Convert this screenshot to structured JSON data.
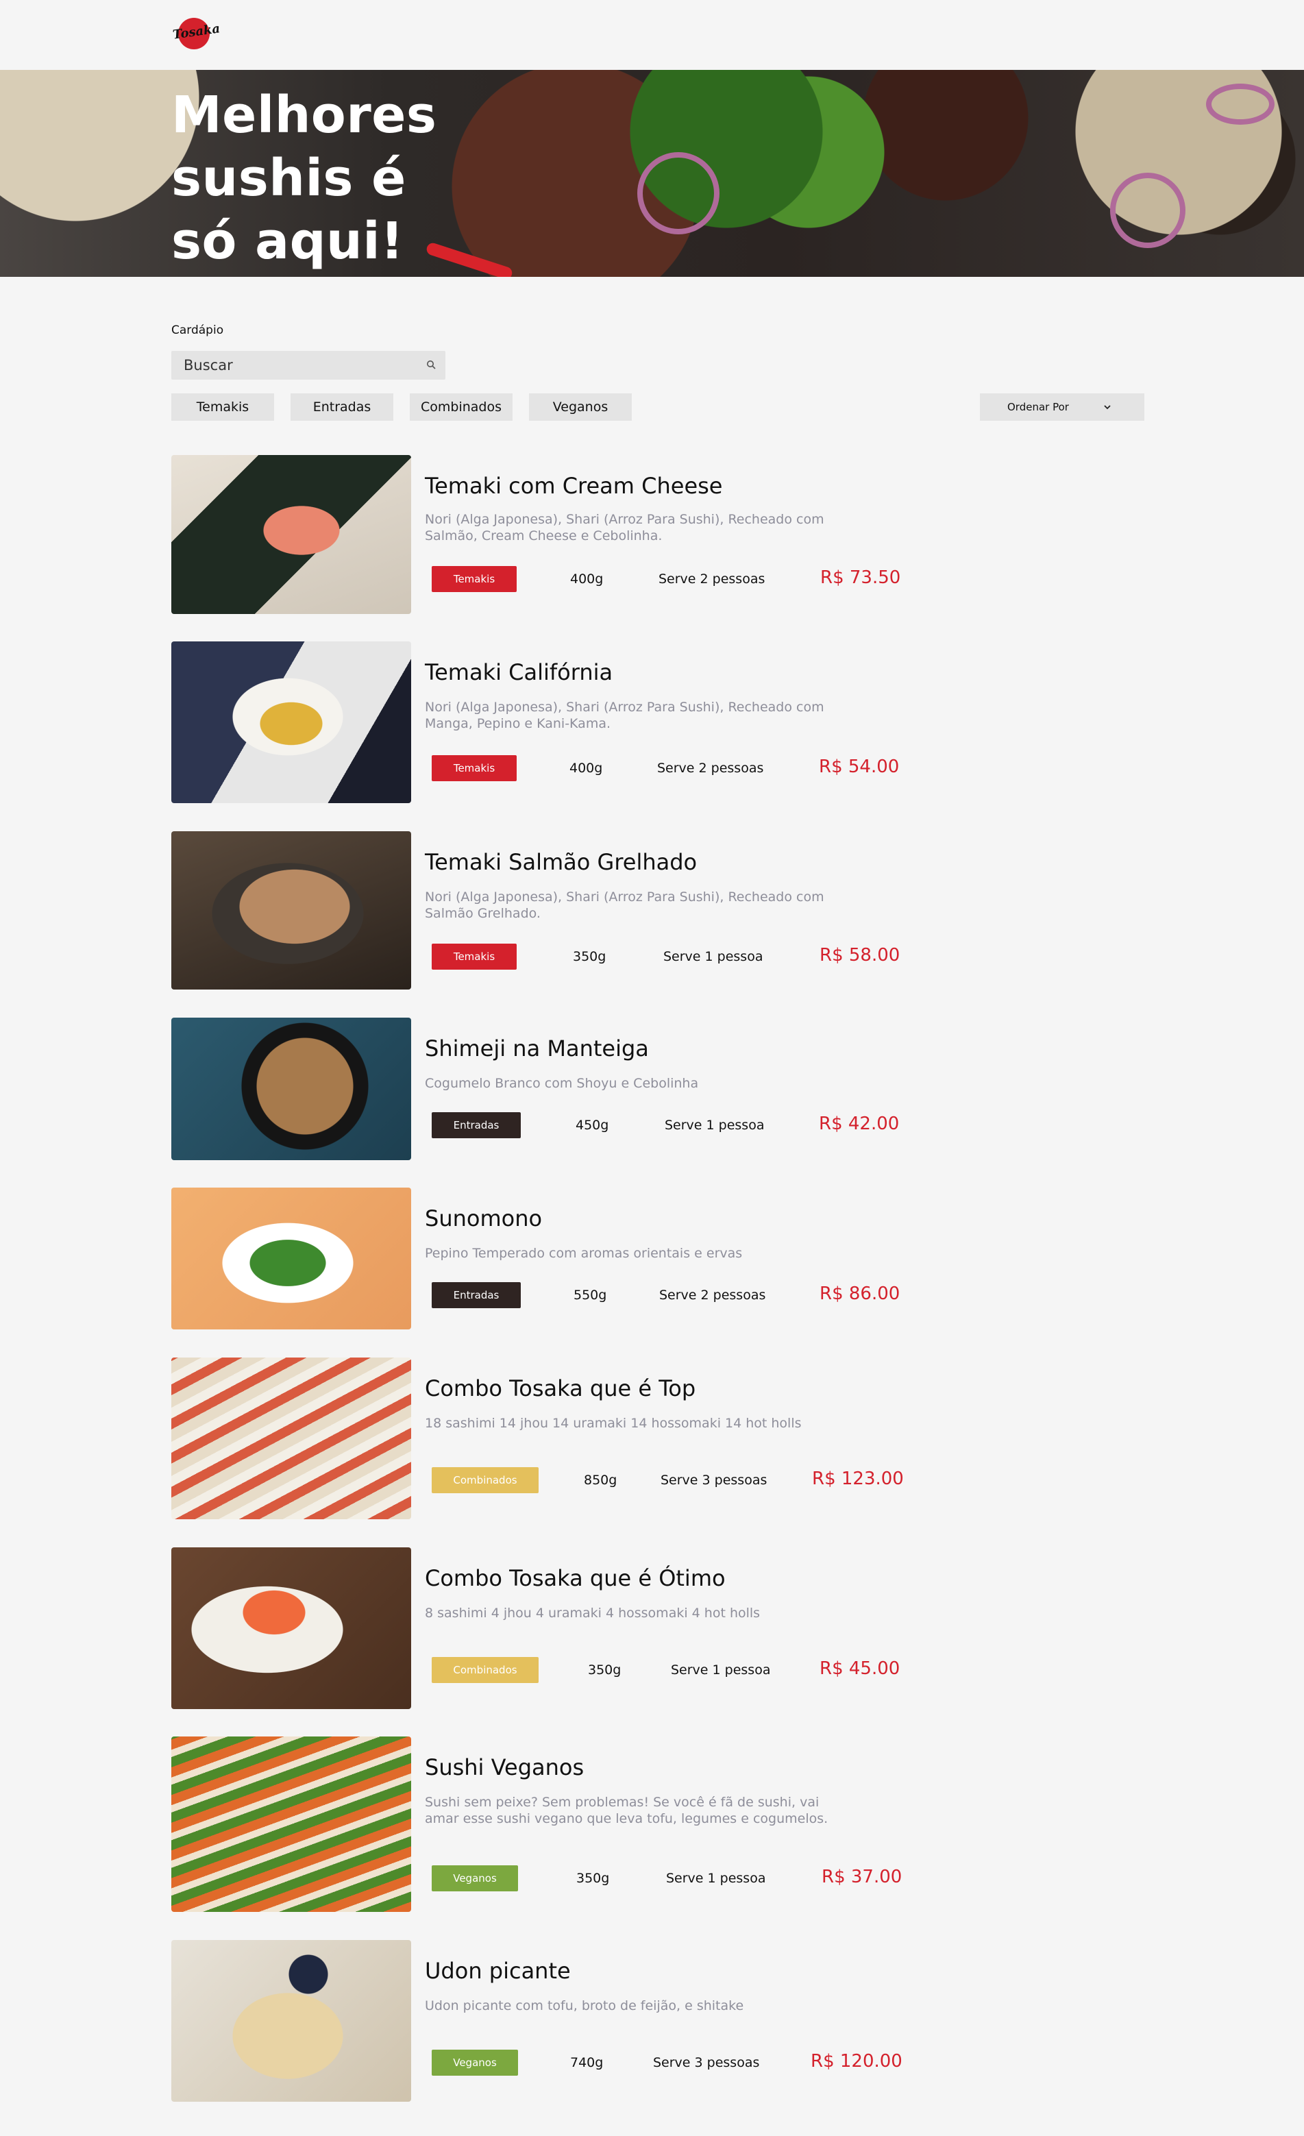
{
  "brand": {
    "logo_text": "Tosaka",
    "red": "#d4212c"
  },
  "hero": {
    "headline": "Melhores sushis é só aqui!"
  },
  "menu": {
    "section_label": "Cardápio",
    "search": {
      "placeholder": "Buscar"
    },
    "tabs": [
      {
        "label": "Temakis"
      },
      {
        "label": "Entradas"
      },
      {
        "label": "Combinados"
      },
      {
        "label": "Veganos"
      }
    ],
    "sort": {
      "label": "Ordenar Por"
    }
  },
  "category_colors": {
    "Temakis": "#d4212c",
    "Entradas": "#2f2422",
    "Combinados": "#e4c05c",
    "Veganos": "#7ca83f"
  },
  "products": [
    {
      "name": "Temaki com Cream Cheese",
      "description": "Nori (Alga Japonesa), Shari (Arroz Para Sushi), Recheado com Salmão, Cream Cheese e Cebolinha.",
      "tag": "Temakis",
      "weight": "400g",
      "serves": "Serve 2 pessoas",
      "price": "R$ 73.50"
    },
    {
      "name": "Temaki Califórnia",
      "description": "Nori (Alga Japonesa), Shari (Arroz Para Sushi), Recheado com Manga, Pepino e Kani-Kama.",
      "tag": "Temakis",
      "weight": "400g",
      "serves": "Serve 2 pessoas",
      "price": "R$ 54.00"
    },
    {
      "name": "Temaki Salmão Grelhado",
      "description": "Nori (Alga Japonesa), Shari (Arroz Para Sushi), Recheado com Salmão Grelhado.",
      "tag": "Temakis",
      "weight": "350g",
      "serves": "Serve 1 pessoa",
      "price": "R$ 58.00"
    },
    {
      "name": "Shimeji na Manteiga",
      "description": "Cogumelo Branco com Shoyu e Cebolinha",
      "tag": "Entradas",
      "weight": "450g",
      "serves": "Serve 1 pessoa",
      "price": "R$ 42.00"
    },
    {
      "name": "Sunomono",
      "description": "Pepino Temperado com aromas orientais e ervas",
      "tag": "Entradas",
      "weight": "550g",
      "serves": "Serve 2 pessoas",
      "price": "R$ 86.00"
    },
    {
      "name": "Combo Tosaka que é Top",
      "description": "18 sashimi 14 jhou 14 uramaki 14 hossomaki 14 hot holls",
      "tag": "Combinados",
      "weight": "850g",
      "serves": "Serve 3 pessoas",
      "price": "R$ 123.00"
    },
    {
      "name": "Combo Tosaka que é Ótimo",
      "description": "8 sashimi 4 jhou 4 uramaki 4 hossomaki 4 hot holls",
      "tag": "Combinados",
      "weight": "350g",
      "serves": "Serve 1 pessoa",
      "price": "R$ 45.00"
    },
    {
      "name": "Sushi Veganos",
      "description": "Sushi sem peixe? Sem problemas! Se você é fã de sushi, vai amar esse sushi vegano que leva tofu, legumes e cogumelos.",
      "tag": "Veganos",
      "weight": "350g",
      "serves": "Serve 1 pessoa",
      "price": "R$ 37.00"
    },
    {
      "name": "Udon picante",
      "description": "Udon picante com tofu, broto de feijão, e shitake",
      "tag": "Veganos",
      "weight": "740g",
      "serves": "Serve 3 pessoas",
      "price": "R$ 120.00"
    }
  ]
}
